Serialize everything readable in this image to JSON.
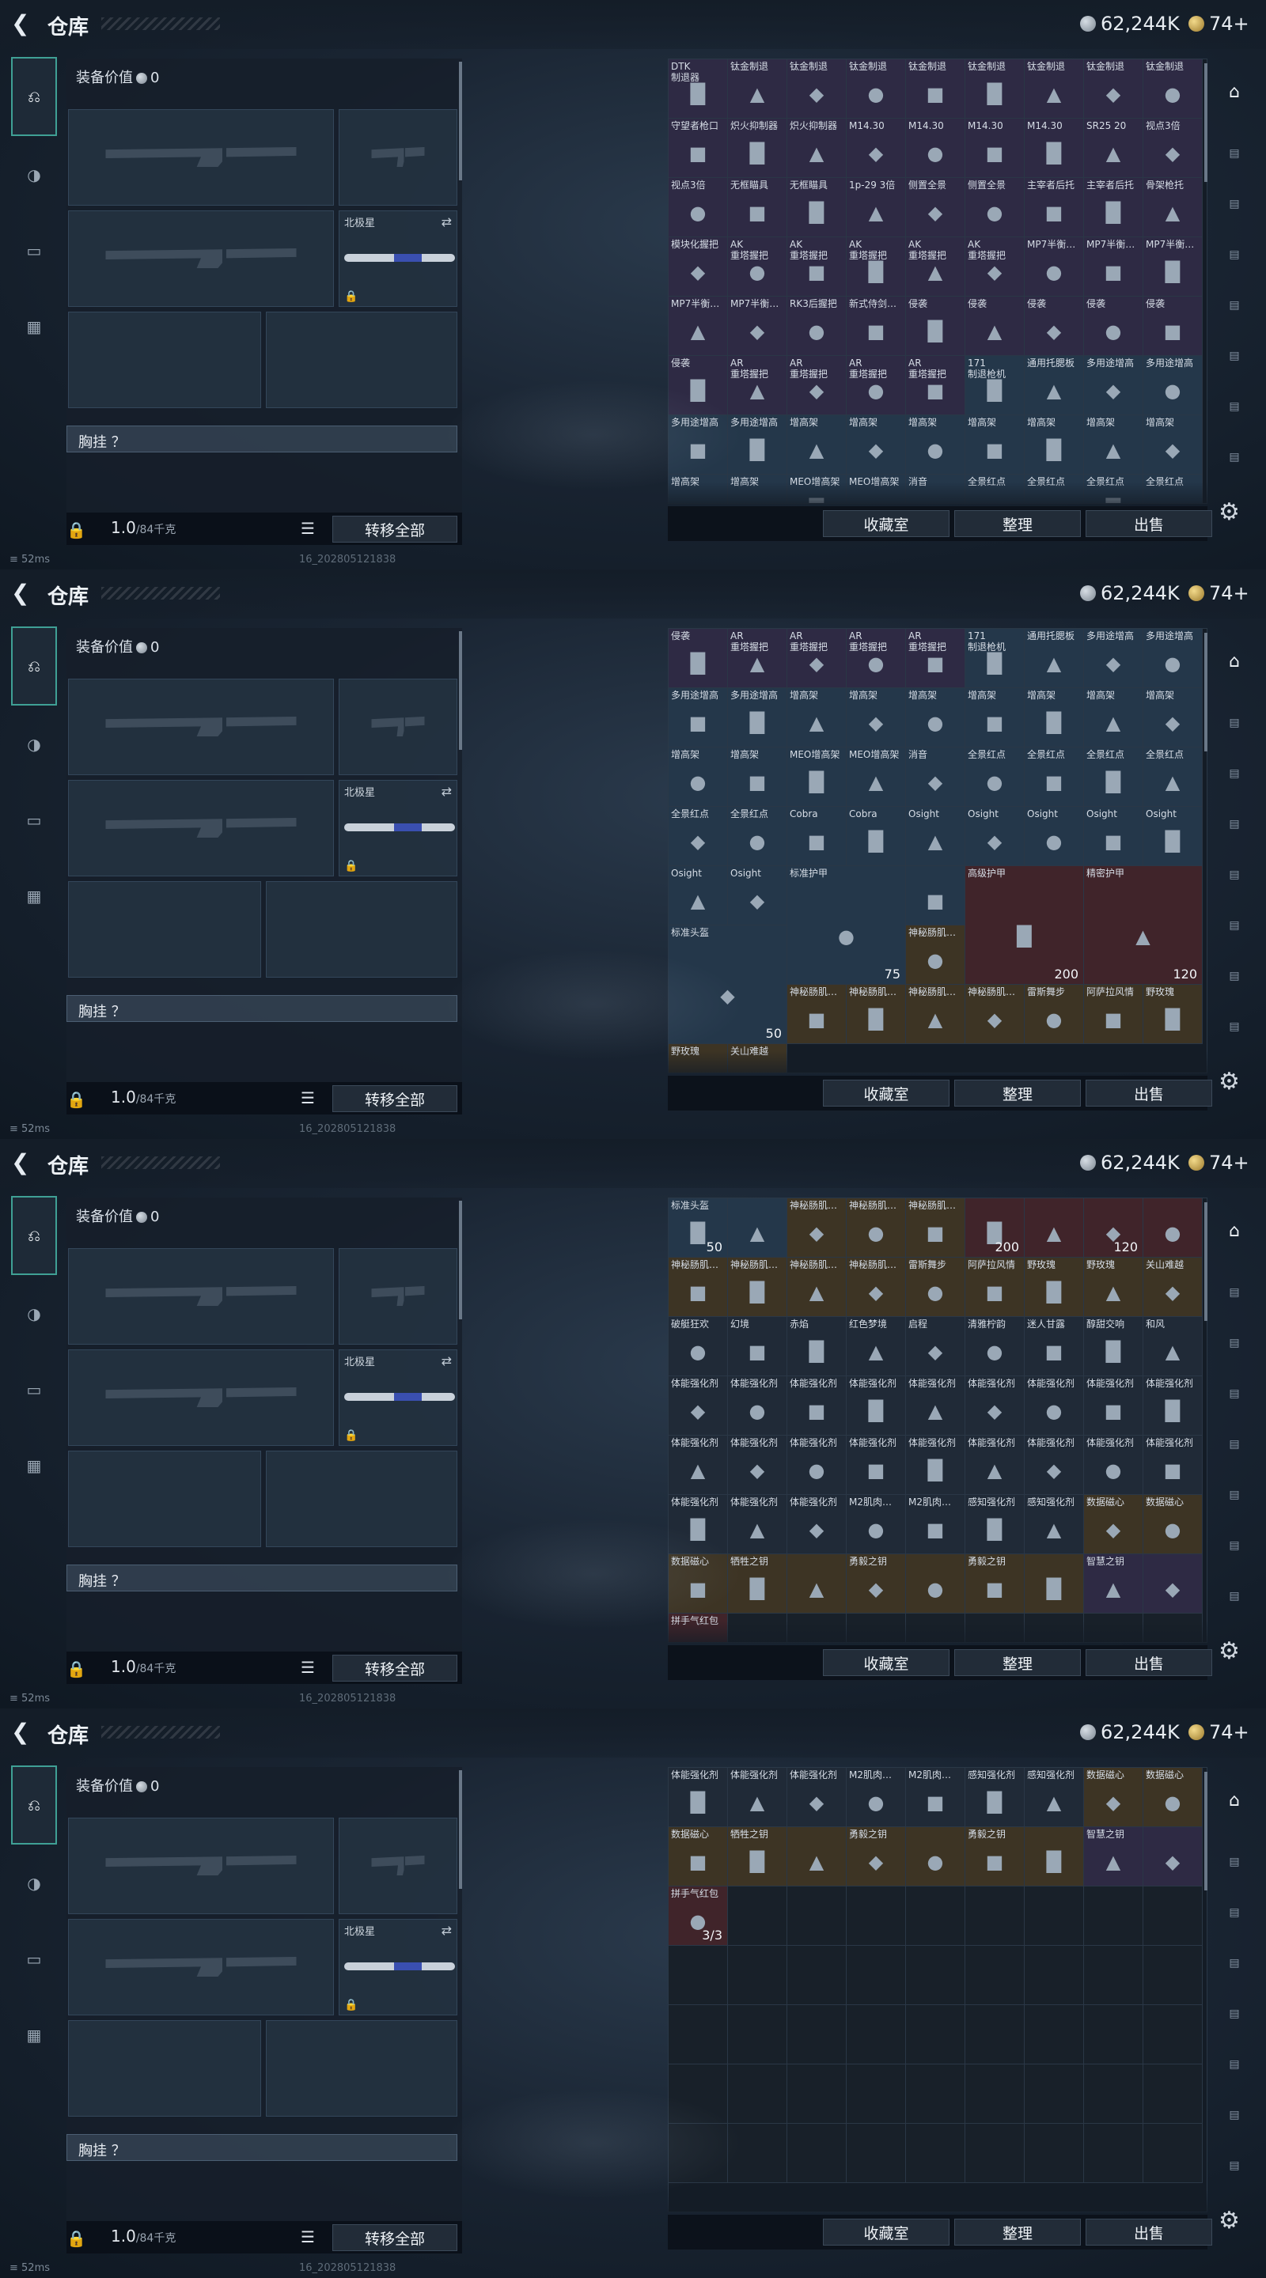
{
  "header": {
    "title": "仓库",
    "back_icon": "back-arrow-icon",
    "currency1": "62,244K",
    "currency2": "74+"
  },
  "leftnav": [
    {
      "icon": "gun-icon"
    },
    {
      "icon": "helmet-icon"
    },
    {
      "icon": "vest-icon"
    },
    {
      "icon": "briefcase-icon"
    }
  ],
  "loadout": {
    "equipment_value_label": "装备价值",
    "equipment_value": "0",
    "knife_name": "北极星",
    "rig_label": "胸挂 ？",
    "weight": "1.0",
    "weight_max": "/84千克",
    "transfer_all": "转移全部"
  },
  "footer": {
    "vault": "收藏室",
    "sort": "整理",
    "sell": "出售"
  },
  "status": {
    "ping": "52ms",
    "build": "16_2028051218​38"
  },
  "frames": [
    {
      "cells": [
        {
          "n": "DTK\n制退器",
          "r": "r-purple"
        },
        {
          "n": "钛金制退",
          "r": "r-purple"
        },
        {
          "n": "钛金制退",
          "r": "r-purple"
        },
        {
          "n": "钛金制退",
          "r": "r-purple"
        },
        {
          "n": "钛金制退",
          "r": "r-purple"
        },
        {
          "n": "钛金制退",
          "r": "r-purple"
        },
        {
          "n": "钛金制退",
          "r": "r-purple"
        },
        {
          "n": "钛金制退",
          "r": "r-purple"
        },
        {
          "n": "钛金制退",
          "r": "r-purple"
        },
        {
          "n": "守望者枪口",
          "r": "r-purple"
        },
        {
          "n": "炽火抑制器",
          "r": "r-purple"
        },
        {
          "n": "炽火抑制器",
          "r": "r-purple"
        },
        {
          "n": "M14.30",
          "r": "r-purple"
        },
        {
          "n": "M14.30",
          "r": "r-purple"
        },
        {
          "n": "M14.30",
          "r": "r-purple"
        },
        {
          "n": "M14.30",
          "r": "r-purple"
        },
        {
          "n": "SR25 20",
          "r": "r-purple"
        },
        {
          "n": "视点3倍",
          "r": "r-purple"
        },
        {
          "n": "视点3倍",
          "r": "r-purple"
        },
        {
          "n": "无框瞄具",
          "r": "r-purple"
        },
        {
          "n": "无框瞄具",
          "r": "r-purple"
        },
        {
          "n": "1p-29 3倍",
          "r": "r-purple"
        },
        {
          "n": "侧置全景",
          "r": "r-purple"
        },
        {
          "n": "侧置全景",
          "r": "r-purple"
        },
        {
          "n": "主宰者后托",
          "r": "r-purple"
        },
        {
          "n": "主宰者后托",
          "r": "r-purple"
        },
        {
          "n": "骨架枪托",
          "r": "r-purple"
        },
        {
          "n": "模块化握把",
          "r": "r-purple"
        },
        {
          "n": "AK\n重塔握把",
          "r": "r-purple"
        },
        {
          "n": "AK\n重塔握把",
          "r": "r-purple"
        },
        {
          "n": "AK\n重塔握把",
          "r": "r-purple"
        },
        {
          "n": "AK\n重塔握把",
          "r": "r-purple"
        },
        {
          "n": "AK\n重塔握把",
          "r": "r-purple"
        },
        {
          "n": "MP7半衡…",
          "r": "r-purple"
        },
        {
          "n": "MP7半衡…",
          "r": "r-purple"
        },
        {
          "n": "MP7半衡…",
          "r": "r-purple"
        },
        {
          "n": "MP7半衡…",
          "r": "r-purple"
        },
        {
          "n": "MP7半衡…",
          "r": "r-purple"
        },
        {
          "n": "RK3后握把",
          "r": "r-purple"
        },
        {
          "n": "新式侍剑…",
          "r": "r-purple"
        },
        {
          "n": "侵袭",
          "r": "r-purple"
        },
        {
          "n": "侵袭",
          "r": "r-purple"
        },
        {
          "n": "侵袭",
          "r": "r-purple"
        },
        {
          "n": "侵袭",
          "r": "r-purple"
        },
        {
          "n": "侵袭",
          "r": "r-purple"
        },
        {
          "n": "侵袭",
          "r": "r-purple"
        },
        {
          "n": "AR\n重塔握把",
          "r": "r-purple"
        },
        {
          "n": "AR\n重塔握把",
          "r": "r-purple"
        },
        {
          "n": "AR\n重塔握把",
          "r": "r-purple"
        },
        {
          "n": "AR\n重塔握把",
          "r": "r-purple"
        },
        {
          "n": "171\n制退枪机",
          "r": "r-blue"
        },
        {
          "n": "通用托腮板",
          "r": "r-blue"
        },
        {
          "n": "多用途增高",
          "r": "r-blue"
        },
        {
          "n": "多用途增高",
          "r": "r-blue"
        },
        {
          "n": "多用途增高",
          "r": "r-blue"
        },
        {
          "n": "多用途增高",
          "r": "r-blue"
        },
        {
          "n": "增高架",
          "r": "r-blue"
        },
        {
          "n": "增高架",
          "r": "r-blue"
        },
        {
          "n": "增高架",
          "r": "r-blue"
        },
        {
          "n": "增高架",
          "r": "r-blue"
        },
        {
          "n": "增高架",
          "r": "r-blue"
        },
        {
          "n": "增高架",
          "r": "r-blue"
        },
        {
          "n": "增高架",
          "r": "r-blue"
        },
        {
          "n": "增高架",
          "r": "r-blue"
        },
        {
          "n": "增高架",
          "r": "r-blue"
        },
        {
          "n": "MEO增高架",
          "r": "r-blue"
        },
        {
          "n": "MEO增高架",
          "r": "r-blue"
        },
        {
          "n": "消音",
          "r": "r-blue"
        },
        {
          "n": "全景红点",
          "r": "r-blue"
        },
        {
          "n": "全景红点",
          "r": "r-blue"
        },
        {
          "n": "全景红点",
          "r": "r-blue"
        },
        {
          "n": "全景红点",
          "r": "r-blue"
        }
      ]
    },
    {
      "cells": [
        {
          "n": "侵袭",
          "r": "r-purple"
        },
        {
          "n": "AR\n重塔握把",
          "r": "r-purple"
        },
        {
          "n": "AR\n重塔握把",
          "r": "r-purple"
        },
        {
          "n": "AR\n重塔握把",
          "r": "r-purple"
        },
        {
          "n": "AR\n重塔握把",
          "r": "r-purple"
        },
        {
          "n": "171\n制退枪机",
          "r": "r-blue"
        },
        {
          "n": "通用托腮板",
          "r": "r-blue"
        },
        {
          "n": "多用途增高",
          "r": "r-blue"
        },
        {
          "n": "多用途增高",
          "r": "r-blue"
        },
        {
          "n": "多用途增高",
          "r": "r-blue"
        },
        {
          "n": "多用途增高",
          "r": "r-blue"
        },
        {
          "n": "增高架",
          "r": "r-blue"
        },
        {
          "n": "增高架",
          "r": "r-blue"
        },
        {
          "n": "增高架",
          "r": "r-blue"
        },
        {
          "n": "增高架",
          "r": "r-blue"
        },
        {
          "n": "增高架",
          "r": "r-blue"
        },
        {
          "n": "增高架",
          "r": "r-blue"
        },
        {
          "n": "增高架",
          "r": "r-blue"
        },
        {
          "n": "增高架",
          "r": "r-blue"
        },
        {
          "n": "增高架",
          "r": "r-blue"
        },
        {
          "n": "MEO增高架",
          "r": "r-blue"
        },
        {
          "n": "MEO增高架",
          "r": "r-blue"
        },
        {
          "n": "消音",
          "r": "r-blue"
        },
        {
          "n": "全景红点",
          "r": "r-blue"
        },
        {
          "n": "全景红点",
          "r": "r-blue"
        },
        {
          "n": "全景红点",
          "r": "r-blue"
        },
        {
          "n": "全景红点",
          "r": "r-blue"
        },
        {
          "n": "全景红点",
          "r": "r-blue"
        },
        {
          "n": "全景红点",
          "r": "r-blue"
        },
        {
          "n": "Cobra",
          "r": "r-blue"
        },
        {
          "n": "Cobra",
          "r": "r-blue"
        },
        {
          "n": "Osight",
          "r": "r-blue"
        },
        {
          "n": "Osight",
          "r": "r-blue"
        },
        {
          "n": "Osight",
          "r": "r-blue"
        },
        {
          "n": "Osight",
          "r": "r-blue"
        },
        {
          "n": "Osight",
          "r": "r-blue"
        },
        {
          "n": "Osight",
          "r": "r-blue"
        },
        {
          "n": "Osight",
          "r": "r-blue"
        },
        {
          "n": "标准护甲",
          "r": "r-blue",
          "big": true,
          "c": "75"
        },
        {
          "n": "",
          "r": "r-blue"
        },
        {
          "n": "高级护甲",
          "r": "r-red",
          "big": true,
          "c": "200"
        },
        {
          "n": "精密护甲",
          "r": "r-red",
          "big": true,
          "c": "120"
        },
        {
          "n": "标准头盔",
          "r": "r-blue",
          "big": true,
          "c": "50"
        },
        {
          "n": "神秘肠肌…",
          "r": "r-gold"
        },
        {
          "n": "神秘肠肌…",
          "r": "r-gold"
        },
        {
          "n": "神秘肠肌…",
          "r": "r-gold"
        },
        {
          "n": "神秘肠肌…",
          "r": "r-gold"
        },
        {
          "n": "神秘肠肌…",
          "r": "r-gold"
        },
        {
          "n": "雷斯舞步",
          "r": "r-gold"
        },
        {
          "n": "阿萨拉风情",
          "r": "r-gold"
        },
        {
          "n": "野玫瑰",
          "r": "r-gold"
        },
        {
          "n": "野玫瑰",
          "r": "r-gold"
        },
        {
          "n": "关山难越",
          "r": "r-gold"
        }
      ]
    },
    {
      "cells": [
        {
          "n": "标准头盔",
          "r": "r-blue",
          "c": "50"
        },
        {
          "n": "",
          "r": "r-blue"
        },
        {
          "n": "神秘肠肌…",
          "r": "r-gold"
        },
        {
          "n": "神秘肠肌…",
          "r": "r-gold"
        },
        {
          "n": "神秘肠肌…",
          "r": "r-gold"
        },
        {
          "n": "",
          "r": "r-red",
          "c": "200"
        },
        {
          "n": "",
          "r": "r-red"
        },
        {
          "n": "",
          "r": "r-red",
          "c": "120"
        },
        {
          "n": "",
          "r": "r-red"
        },
        {
          "n": "神秘肠肌…",
          "r": "r-gold"
        },
        {
          "n": "神秘肠肌…",
          "r": "r-gold"
        },
        {
          "n": "神秘肠肌…",
          "r": "r-gold"
        },
        {
          "n": "神秘肠肌…",
          "r": "r-gold"
        },
        {
          "n": "雷斯舞步",
          "r": "r-gold"
        },
        {
          "n": "阿萨拉风情",
          "r": "r-gold"
        },
        {
          "n": "野玫瑰",
          "r": "r-gold"
        },
        {
          "n": "野玫瑰",
          "r": "r-gold"
        },
        {
          "n": "关山难越",
          "r": "r-gold"
        },
        {
          "n": "破艇狂欢",
          "r": ""
        },
        {
          "n": "幻境",
          "r": ""
        },
        {
          "n": "赤焰",
          "r": ""
        },
        {
          "n": "红色梦境",
          "r": ""
        },
        {
          "n": "启程",
          "r": ""
        },
        {
          "n": "清雅柠韵",
          "r": ""
        },
        {
          "n": "迷人甘露",
          "r": ""
        },
        {
          "n": "醇甜交响",
          "r": ""
        },
        {
          "n": "和风",
          "r": ""
        },
        {
          "n": "体能强化剂",
          "r": ""
        },
        {
          "n": "体能强化剂",
          "r": ""
        },
        {
          "n": "体能强化剂",
          "r": ""
        },
        {
          "n": "体能强化剂",
          "r": ""
        },
        {
          "n": "体能强化剂",
          "r": ""
        },
        {
          "n": "体能强化剂",
          "r": ""
        },
        {
          "n": "体能强化剂",
          "r": ""
        },
        {
          "n": "体能强化剂",
          "r": ""
        },
        {
          "n": "体能强化剂",
          "r": ""
        },
        {
          "n": "体能强化剂",
          "r": ""
        },
        {
          "n": "体能强化剂",
          "r": ""
        },
        {
          "n": "体能强化剂",
          "r": ""
        },
        {
          "n": "体能强化剂",
          "r": ""
        },
        {
          "n": "体能强化剂",
          "r": ""
        },
        {
          "n": "体能强化剂",
          "r": ""
        },
        {
          "n": "体能强化剂",
          "r": ""
        },
        {
          "n": "体能强化剂",
          "r": ""
        },
        {
          "n": "体能强化剂",
          "r": ""
        },
        {
          "n": "体能强化剂",
          "r": ""
        },
        {
          "n": "体能强化剂",
          "r": ""
        },
        {
          "n": "体能强化剂",
          "r": ""
        },
        {
          "n": "M2肌肉…",
          "r": ""
        },
        {
          "n": "M2肌肉…",
          "r": ""
        },
        {
          "n": "感知强化剂",
          "r": ""
        },
        {
          "n": "感知强化剂",
          "r": ""
        },
        {
          "n": "数据磁心",
          "r": "r-gold"
        },
        {
          "n": "数据磁心",
          "r": "r-gold"
        },
        {
          "n": "数据磁心",
          "r": "r-gold"
        },
        {
          "n": "牺牲之钥",
          "r": "r-gold"
        },
        {
          "n": "",
          "r": "r-gold"
        },
        {
          "n": "勇毅之钥",
          "r": "r-gold"
        },
        {
          "n": "",
          "r": "r-gold"
        },
        {
          "n": "勇毅之钥",
          "r": "r-gold"
        },
        {
          "n": "",
          "r": "r-gold"
        },
        {
          "n": "智慧之钥",
          "r": "r-purple"
        },
        {
          "n": "",
          "r": "r-purple"
        },
        {
          "n": "拼手气红包",
          "r": "r-red"
        },
        {
          "n": "",
          "r": "empty"
        },
        {
          "n": "",
          "r": "empty"
        },
        {
          "n": "",
          "r": "empty"
        },
        {
          "n": "",
          "r": "empty"
        },
        {
          "n": "",
          "r": "empty"
        },
        {
          "n": "",
          "r": "empty"
        },
        {
          "n": "",
          "r": "empty"
        },
        {
          "n": "",
          "r": "empty"
        }
      ]
    },
    {
      "cells": [
        {
          "n": "体能强化剂",
          "r": ""
        },
        {
          "n": "体能强化剂",
          "r": ""
        },
        {
          "n": "体能强化剂",
          "r": ""
        },
        {
          "n": "M2肌肉…",
          "r": ""
        },
        {
          "n": "M2肌肉…",
          "r": ""
        },
        {
          "n": "感知强化剂",
          "r": ""
        },
        {
          "n": "感知强化剂",
          "r": ""
        },
        {
          "n": "数据磁心",
          "r": "r-gold"
        },
        {
          "n": "数据磁心",
          "r": "r-gold"
        },
        {
          "n": "数据磁心",
          "r": "r-gold"
        },
        {
          "n": "牺牲之钥",
          "r": "r-gold"
        },
        {
          "n": "",
          "r": "r-gold"
        },
        {
          "n": "勇毅之钥",
          "r": "r-gold"
        },
        {
          "n": "",
          "r": "r-gold"
        },
        {
          "n": "勇毅之钥",
          "r": "r-gold"
        },
        {
          "n": "",
          "r": "r-gold"
        },
        {
          "n": "智慧之钥",
          "r": "r-purple"
        },
        {
          "n": "",
          "r": "r-purple"
        },
        {
          "n": "拼手气红包",
          "r": "r-red",
          "c": "3/3"
        },
        {
          "n": "",
          "r": "empty"
        },
        {
          "n": "",
          "r": "empty"
        },
        {
          "n": "",
          "r": "empty"
        },
        {
          "n": "",
          "r": "empty"
        },
        {
          "n": "",
          "r": "empty"
        },
        {
          "n": "",
          "r": "empty"
        },
        {
          "n": "",
          "r": "empty"
        },
        {
          "n": "",
          "r": "empty"
        },
        {
          "n": "",
          "r": "empty"
        },
        {
          "n": "",
          "r": "empty"
        },
        {
          "n": "",
          "r": "empty"
        },
        {
          "n": "",
          "r": "empty"
        },
        {
          "n": "",
          "r": "empty"
        },
        {
          "n": "",
          "r": "empty"
        },
        {
          "n": "",
          "r": "empty"
        },
        {
          "n": "",
          "r": "empty"
        },
        {
          "n": "",
          "r": "empty"
        },
        {
          "n": "",
          "r": "empty"
        },
        {
          "n": "",
          "r": "empty"
        },
        {
          "n": "",
          "r": "empty"
        },
        {
          "n": "",
          "r": "empty"
        },
        {
          "n": "",
          "r": "empty"
        },
        {
          "n": "",
          "r": "empty"
        },
        {
          "n": "",
          "r": "empty"
        },
        {
          "n": "",
          "r": "empty"
        },
        {
          "n": "",
          "r": "empty"
        },
        {
          "n": "",
          "r": "empty"
        },
        {
          "n": "",
          "r": "empty"
        },
        {
          "n": "",
          "r": "empty"
        },
        {
          "n": "",
          "r": "empty"
        },
        {
          "n": "",
          "r": "empty"
        },
        {
          "n": "",
          "r": "empty"
        },
        {
          "n": "",
          "r": "empty"
        },
        {
          "n": "",
          "r": "empty"
        },
        {
          "n": "",
          "r": "empty"
        },
        {
          "n": "",
          "r": "empty"
        },
        {
          "n": "",
          "r": "empty"
        },
        {
          "n": "",
          "r": "empty"
        },
        {
          "n": "",
          "r": "empty"
        },
        {
          "n": "",
          "r": "empty"
        },
        {
          "n": "",
          "r": "empty"
        },
        {
          "n": "",
          "r": "empty"
        },
        {
          "n": "",
          "r": "empty"
        },
        {
          "n": "",
          "r": "empty"
        }
      ]
    }
  ]
}
